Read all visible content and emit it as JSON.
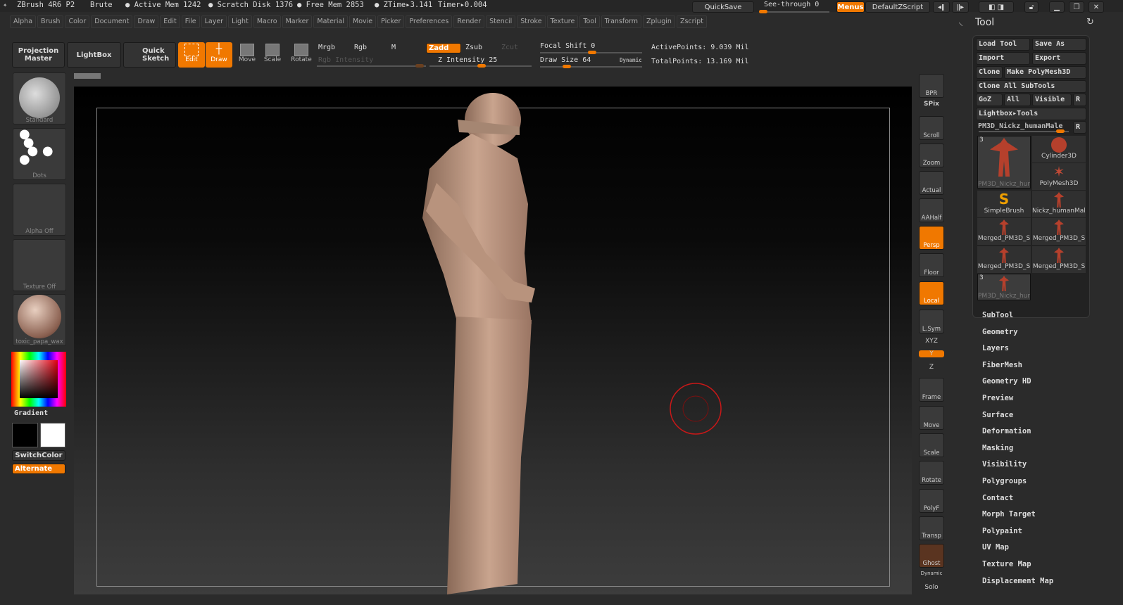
{
  "topbar": {
    "app": "ZBrush 4R6 P2",
    "brush": "Brute",
    "active_mem": "● Active Mem 1242",
    "scratch": "● Scratch Disk 1376",
    "free_mem": "● Free Mem 2853",
    "ztime": "● ZTime▸3.141",
    "timer": "Timer▸0.004",
    "quicksave": "QuickSave",
    "see_through": "See-through  0",
    "see_through_value": 0,
    "menus": "Menus",
    "script": "DefaultZScript"
  },
  "menu_items": [
    "Alpha",
    "Brush",
    "Color",
    "Document",
    "Draw",
    "Edit",
    "File",
    "Layer",
    "Light",
    "Macro",
    "Marker",
    "Material",
    "Movie",
    "Picker",
    "Preferences",
    "Render",
    "Stencil",
    "Stroke",
    "Texture",
    "Tool",
    "Transform",
    "Zplugin",
    "Zscript"
  ],
  "toolbar": {
    "projection_master": "Projection Master",
    "lightbox": "LightBox",
    "quick_sketch": "Quick Sketch",
    "edit": "Edit",
    "draw": "Draw",
    "move": "Move",
    "scale": "Scale",
    "rotate": "Rotate",
    "mrgb": "Mrgb",
    "rgb": "Rgb",
    "m": "M",
    "zadd": "Zadd",
    "zsub": "Zsub",
    "zcut": "Zcut",
    "rgb_intensity": "Rgb Intensity",
    "z_intensity": "Z Intensity 25",
    "z_intensity_value": 25,
    "focal_shift": "Focal Shift 0",
    "focal_shift_value": 0,
    "draw_size": "Draw Size 64",
    "draw_size_value": 64,
    "dynamic": "Dynamic",
    "active_points": "ActivePoints: 9.039 Mil",
    "total_points": "TotalPoints: 13.169 Mil"
  },
  "left": {
    "brush": "Standard",
    "stroke": "Dots",
    "alpha": "Alpha  Off",
    "texture": "Texture  Off",
    "material": "toxic_papa_wax",
    "gradient": "Gradient",
    "switch_color": "SwitchColor",
    "alternate": "Alternate",
    "colors": {
      "main": "#000000",
      "secondary": "#ffffff"
    }
  },
  "shelf": [
    "BPR",
    "SPix",
    "Scroll",
    "Zoom",
    "Actual",
    "AAHalf",
    "Persp",
    "Floor",
    "Local",
    "L.Sym",
    "XYZ",
    "Y",
    "Z",
    "Frame",
    "Move",
    "Scale",
    "Rotate",
    "PolyF",
    "Transp",
    "Ghost",
    "Dynamic",
    "Solo"
  ],
  "tool_panel": {
    "title": "Tool",
    "load_tool": "Load Tool",
    "save_as": "Save As",
    "import": "Import",
    "export": "Export",
    "clone": "Clone",
    "make_polymesh": "Make PolyMesh3D",
    "clone_all": "Clone All SubTools",
    "goz": "GoZ",
    "all": "All",
    "visible": "Visible",
    "r": "R",
    "lightbox_tools": "Lightbox▸Tools",
    "current_tool": "PM3D_Nickz_humanMale",
    "tools": [
      {
        "name": "PM3D_Nickz_hur",
        "badge": "3"
      },
      {
        "name": "Cylinder3D"
      },
      {
        "name": "PolyMesh3D"
      },
      {
        "name": "SimpleBrush"
      },
      {
        "name": "Nickz_humanMale"
      },
      {
        "name": "Merged_PM3D_S"
      },
      {
        "name": "Merged_PM3D_S"
      },
      {
        "name": "Merged_PM3D_S"
      },
      {
        "name": "Merged_PM3D_S"
      },
      {
        "name": "PM3D_Nickz_hur",
        "badge": "3"
      }
    ],
    "sections": [
      "SubTool",
      "Geometry",
      "Layers",
      "FiberMesh",
      "Geometry HD",
      "Preview",
      "Surface",
      "Deformation",
      "Masking",
      "Visibility",
      "Polygroups",
      "Contact",
      "Morph Target",
      "Polypaint",
      "UV Map",
      "Texture Map",
      "Displacement Map"
    ]
  },
  "accent": "#f07800"
}
